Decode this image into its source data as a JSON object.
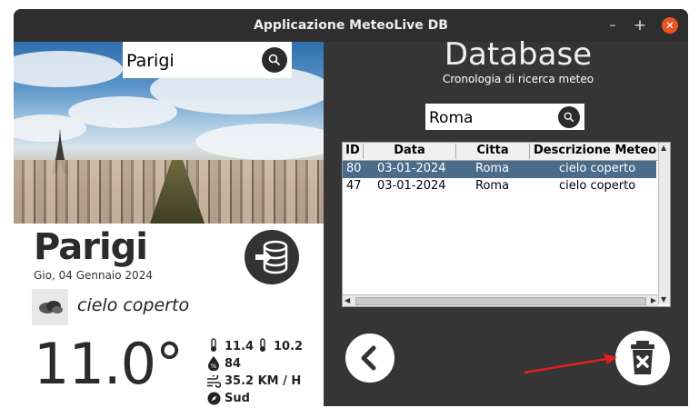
{
  "window": {
    "title": "Applicazione MeteoLive DB",
    "min": "–",
    "max": "+",
    "close": "✕"
  },
  "left": {
    "search": {
      "value": "Parigi"
    },
    "city": "Parigi",
    "date": "Gio, 04 Gennaio 2024",
    "description": "cielo coperto",
    "temperature": "11.0°",
    "temp_max": "11.4",
    "temp_min": "10.2",
    "humidity": "84",
    "wind_speed": "35.2 KM / H",
    "wind_dir": "Sud"
  },
  "right": {
    "title": "Database",
    "subtitle": "Cronologia di ricerca meteo",
    "search": {
      "value": "Roma"
    },
    "table": {
      "headers": [
        "ID",
        "Data",
        "Citta",
        "Descrizione Meteo"
      ],
      "rows": [
        {
          "id": "80",
          "data": "03-01-2024",
          "citta": "Roma",
          "descrizione": "cielo coperto",
          "selected": true
        },
        {
          "id": "47",
          "data": "03-01-2024",
          "citta": "Roma",
          "descrizione": "cielo coperto",
          "selected": false
        }
      ]
    }
  },
  "colors": {
    "panel": "#353535",
    "selected_row": "#4a6b8a",
    "close_button": "#e95420",
    "annotation_arrow": "#e02020"
  }
}
